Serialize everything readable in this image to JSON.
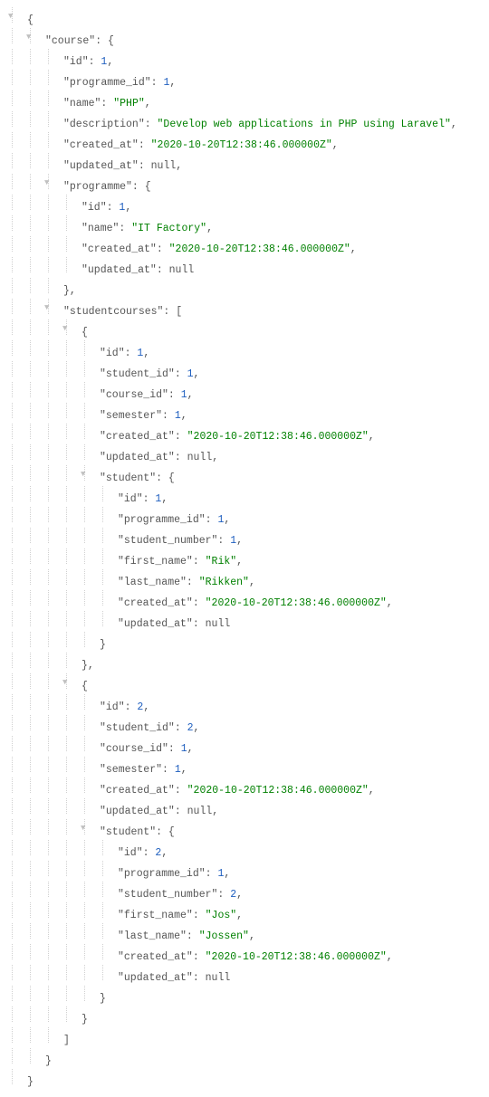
{
  "json": {
    "course_key": "\"course\"",
    "id_key": "\"id\"",
    "programme_id_key": "\"programme_id\"",
    "name_key": "\"name\"",
    "description_key": "\"description\"",
    "created_at_key": "\"created_at\"",
    "updated_at_key": "\"updated_at\"",
    "programme_key": "\"programme\"",
    "studentcourses_key": "\"studentcourses\"",
    "student_id_key": "\"student_id\"",
    "course_id_key": "\"course_id\"",
    "semester_key": "\"semester\"",
    "student_key": "\"student\"",
    "student_number_key": "\"student_number\"",
    "first_name_key": "\"first_name\"",
    "last_name_key": "\"last_name\"",
    "course": {
      "id": "1",
      "programme_id": "1",
      "name": "\"PHP\"",
      "description": "\"Develop web applications in PHP using Laravel\"",
      "created_at": "\"2020-10-20T12:38:46.000000Z\"",
      "updated_at": "null",
      "programme": {
        "id": "1",
        "name": "\"IT Factory\"",
        "created_at": "\"2020-10-20T12:38:46.000000Z\"",
        "updated_at": "null"
      },
      "studentcourses": [
        {
          "id": "1",
          "student_id": "1",
          "course_id": "1",
          "semester": "1",
          "created_at": "\"2020-10-20T12:38:46.000000Z\"",
          "updated_at": "null",
          "student": {
            "id": "1",
            "programme_id": "1",
            "student_number": "1",
            "first_name": "\"Rik\"",
            "last_name": "\"Rikken\"",
            "created_at": "\"2020-10-20T12:38:46.000000Z\"",
            "updated_at": "null"
          }
        },
        {
          "id": "2",
          "student_id": "2",
          "course_id": "1",
          "semester": "1",
          "created_at": "\"2020-10-20T12:38:46.000000Z\"",
          "updated_at": "null",
          "student": {
            "id": "2",
            "programme_id": "1",
            "student_number": "2",
            "first_name": "\"Jos\"",
            "last_name": "\"Jossen\"",
            "created_at": "\"2020-10-20T12:38:46.000000Z\"",
            "updated_at": "null"
          }
        }
      ]
    }
  }
}
